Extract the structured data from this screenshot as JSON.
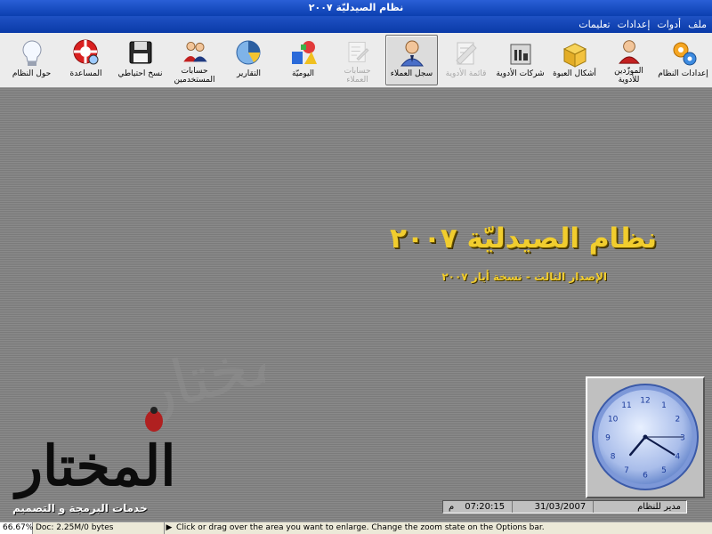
{
  "window": {
    "title": "نظام الصيدليّة ٢٠٠٧"
  },
  "menu": [
    "ملف",
    "أدوات",
    "إعدادات",
    "تعليمات"
  ],
  "toolbar": [
    {
      "label": "إعدادات النظام",
      "icon": "gears-icon",
      "disabled": false,
      "active": false
    },
    {
      "label": "الموزّدين للأدوية",
      "icon": "supplier-person-icon",
      "disabled": false,
      "active": false
    },
    {
      "label": "أشكال العبوة",
      "icon": "open-box-icon",
      "disabled": false,
      "active": false
    },
    {
      "label": "شركات الأدوية",
      "icon": "factory-icon",
      "disabled": false,
      "active": false
    },
    {
      "label": "قائمة الأدوية",
      "icon": "list-ruler-icon",
      "disabled": true,
      "active": false
    },
    {
      "label": "سجل العملاء",
      "icon": "customer-person-icon",
      "disabled": false,
      "active": true
    },
    {
      "label": "حسابات العملاء",
      "icon": "customer-accounts-icon",
      "disabled": true,
      "active": false
    },
    {
      "label": "اليوميّة",
      "icon": "colorful-shapes-icon",
      "disabled": false,
      "active": false
    },
    {
      "label": "التقارير",
      "icon": "pie-chart-icon",
      "disabled": false,
      "active": false
    },
    {
      "label": "حسابات\nالمستخدمين",
      "icon": "users-icon",
      "disabled": false,
      "active": false
    },
    {
      "label": "نسخ احتياطي",
      "icon": "floppy-disk-icon",
      "disabled": false,
      "active": false
    },
    {
      "label": "المساعدة",
      "icon": "help-lifebuoy-icon",
      "disabled": false,
      "active": false
    },
    {
      "label": "حول النظام",
      "icon": "light-bulb-icon",
      "disabled": false,
      "active": false
    }
  ],
  "main": {
    "app_title": "نظام الصيدليّة ٢٠٠٧",
    "app_subtitle": "الإصدار الثالث - نسخة أيار ٢٠٠٧"
  },
  "brand": {
    "logo_text": "المختار",
    "tagline": "خدمات البرمجة و التصميم"
  },
  "clock": {
    "hour": 7,
    "minute": 20,
    "second": 15,
    "numbers": [
      "12",
      "1",
      "2",
      "3",
      "4",
      "5",
      "6",
      "7",
      "8",
      "9",
      "10",
      "11"
    ]
  },
  "infobar": {
    "user": "مدير للنظام",
    "date": "31/03/2007",
    "time": "07:20:15",
    "ampm": "م"
  },
  "browser_status": {
    "zoom": "66.67%",
    "doc": "Doc: 2.25M/0 bytes",
    "message": "Click or drag over the area you want to enlarge. Change the zoom state on the Options bar."
  },
  "colors": {
    "title_yellow": "#f1cd2e",
    "titlebar_blue": "#0b3fb0",
    "clock_face": "#9fb6e8"
  }
}
